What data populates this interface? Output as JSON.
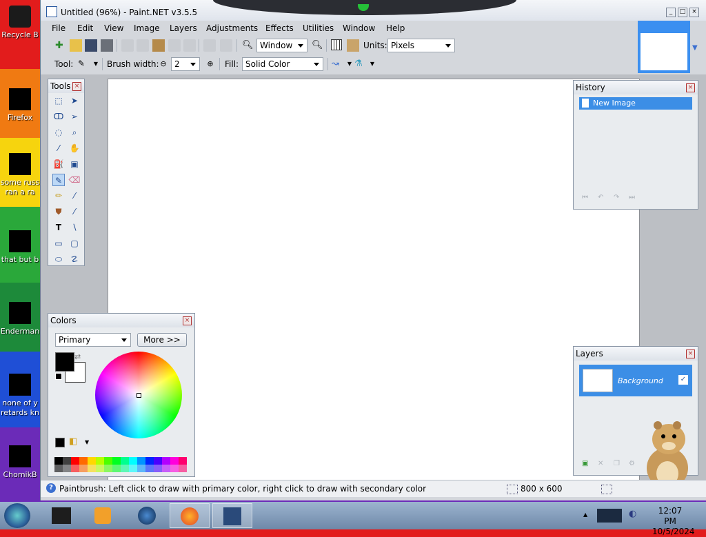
{
  "desktop": {
    "icons": [
      {
        "label": "Recycle B",
        "name": "recycle-bin"
      },
      {
        "label": "Firefox",
        "name": "firefox"
      },
      {
        "label": "some russ",
        "label2": "ran a ra",
        "name": "some-russ"
      },
      {
        "label": "that but b",
        "name": "that-but"
      },
      {
        "label": "Enderman",
        "name": "enderman"
      },
      {
        "label": "none of y",
        "label2": "retards kn",
        "name": "none-of-y"
      },
      {
        "label": "ChomikB",
        "name": "chomikb"
      }
    ]
  },
  "window": {
    "title": "Untitled (96%) - Paint.NET v3.5.5",
    "menu": [
      "File",
      "Edit",
      "View",
      "Image",
      "Layers",
      "Adjustments",
      "Effects",
      "Utilities",
      "Window",
      "Help"
    ],
    "toolbar": {
      "zoom_value": "Window",
      "units_label": "Units:",
      "units_value": "Pixels",
      "tool_label": "Tool:",
      "brush_width_label": "Brush width:",
      "brush_width_value": "2",
      "fill_label": "Fill:",
      "fill_value": "Solid Color"
    }
  },
  "panels": {
    "tools": {
      "title": "Tools"
    },
    "history": {
      "title": "History",
      "items": [
        "New Image"
      ]
    },
    "layers": {
      "title": "Layers",
      "items": [
        "Background"
      ]
    },
    "colors": {
      "title": "Colors",
      "mode": "Primary",
      "more_label": "More >>"
    }
  },
  "status": {
    "text": "Paintbrush: Left click to draw with primary color, right click to draw with secondary color",
    "image_size": "800 x 600"
  },
  "taskbar": {
    "time": "12:07 PM",
    "date": "10/5/2024"
  },
  "colors": {
    "accent": "#3c8ee6",
    "primary_color": "#000000",
    "secondary_color": "#ffffff"
  },
  "palette": [
    "#000000",
    "#404040",
    "#ff0000",
    "#ff6a00",
    "#ffd800",
    "#b6ff00",
    "#4cff00",
    "#00ff21",
    "#00ff90",
    "#00ffff",
    "#0094ff",
    "#0026ff",
    "#4800ff",
    "#b200ff",
    "#ff00dc",
    "#ff006e"
  ]
}
